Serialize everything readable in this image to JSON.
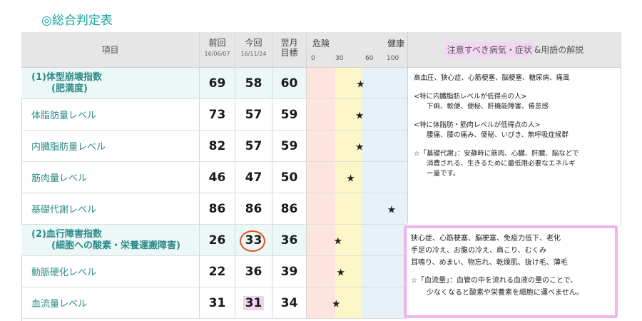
{
  "title": "◎総合判定表",
  "header": {
    "item": "項目",
    "prev": {
      "label": "前回",
      "date": "16/06/07"
    },
    "curr": {
      "label": "今回",
      "date": "16/11/24"
    },
    "target": {
      "label1": "翌月",
      "label2": "目標"
    },
    "gauge": {
      "danger": "危険",
      "healthy": "健康",
      "ticks": [
        "0",
        "30",
        "60",
        "100"
      ]
    },
    "notes": {
      "highlight": "注意すべき病気・症状",
      "rest": "&用語の解説"
    }
  },
  "rows": [
    {
      "label": "(1)体型崩壊指数",
      "label2": "(肥満度)",
      "prev": "69",
      "curr": "58",
      "target": "60",
      "score": 58,
      "group": true
    },
    {
      "label": "体脂肪量レベル",
      "prev": "73",
      "curr": "57",
      "target": "59",
      "score": 57
    },
    {
      "label": "内臓脂肪量レベル",
      "prev": "82",
      "curr": "57",
      "target": "59",
      "score": 57
    },
    {
      "label": "筋肉量レベル",
      "prev": "46",
      "curr": "47",
      "target": "50",
      "score": 47
    },
    {
      "label": "基礎代謝レベル",
      "prev": "86",
      "curr": "86",
      "target": "86",
      "score": 86
    },
    {
      "label": "(2)血行障害指数",
      "label2": "(細胞への酸素・栄養運搬障害)",
      "prev": "26",
      "curr": "33",
      "target": "36",
      "score": 33,
      "group": true,
      "circled": true
    },
    {
      "label": "動脈硬化レベル",
      "prev": "22",
      "curr": "36",
      "target": "39",
      "score": 36
    },
    {
      "label": "血流量レベル",
      "prev": "31",
      "curr": "31",
      "target": "34",
      "score": 31,
      "highlight": true
    }
  ],
  "gauge_bands": [
    {
      "from": 0,
      "to": 30,
      "color": "#fde5dd"
    },
    {
      "from": 30,
      "to": 60,
      "color": "#fcf6c8"
    },
    {
      "from": 60,
      "to": 100,
      "color": "#e6f1fa"
    }
  ],
  "notes1": {
    "line1": "高血圧、狭心症、心筋梗塞、脳梗塞、糖尿病、痛風",
    "line2": "<特に内臓脂肪レベルが低得点の人>",
    "line3": "下痢、軟便、便秘、肝機能障害、倦怠感",
    "line4": "<特に体脂肪・筋肉レベルが低得点の人>",
    "line5": "腰痛、膝の痛み、便秘、いびき、無呼吸症候群",
    "line6": "☆「基礎代謝」：安静時に筋肉、心臓、肝臓、脳などで",
    "line7": "消費される、生きるために最低限必要なエネルギ",
    "line8": "ー量です。"
  },
  "notes2": {
    "line1": "狭心症、心筋梗塞、脳梗塞、免疫力低下、老化",
    "line2": "手足の冷え、お腹の冷え、肩こり、むくみ",
    "line3": "耳鳴り、めまい、物忘れ、乾燥肌、抜け毛、薄毛",
    "line4": "☆「血流量」：血管の中を流れる血液の量のことで、",
    "line5": "少なくなると酸素や栄養素を細胞に運べません。"
  }
}
